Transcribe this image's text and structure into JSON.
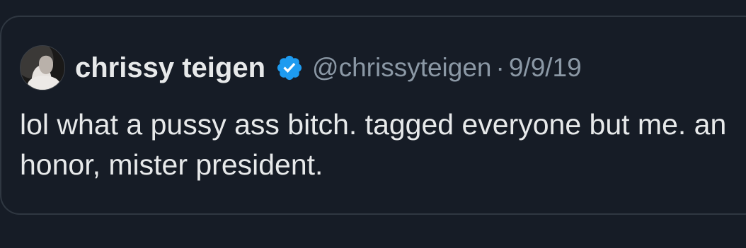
{
  "quoted_tweet": {
    "author": {
      "display_name": "chrissy teigen",
      "handle": "@chrissyteigen",
      "verified": true,
      "verified_badge_color": "#1d9bf0"
    },
    "separator": "·",
    "date": "9/9/19",
    "text": "lol what a pussy ass bitch. tagged everyone but me. an honor, mister president."
  },
  "colors": {
    "background": "#161c26",
    "primary_text": "#e7e9ea",
    "secondary_text": "#8b98a5",
    "border": "#2f3741"
  }
}
